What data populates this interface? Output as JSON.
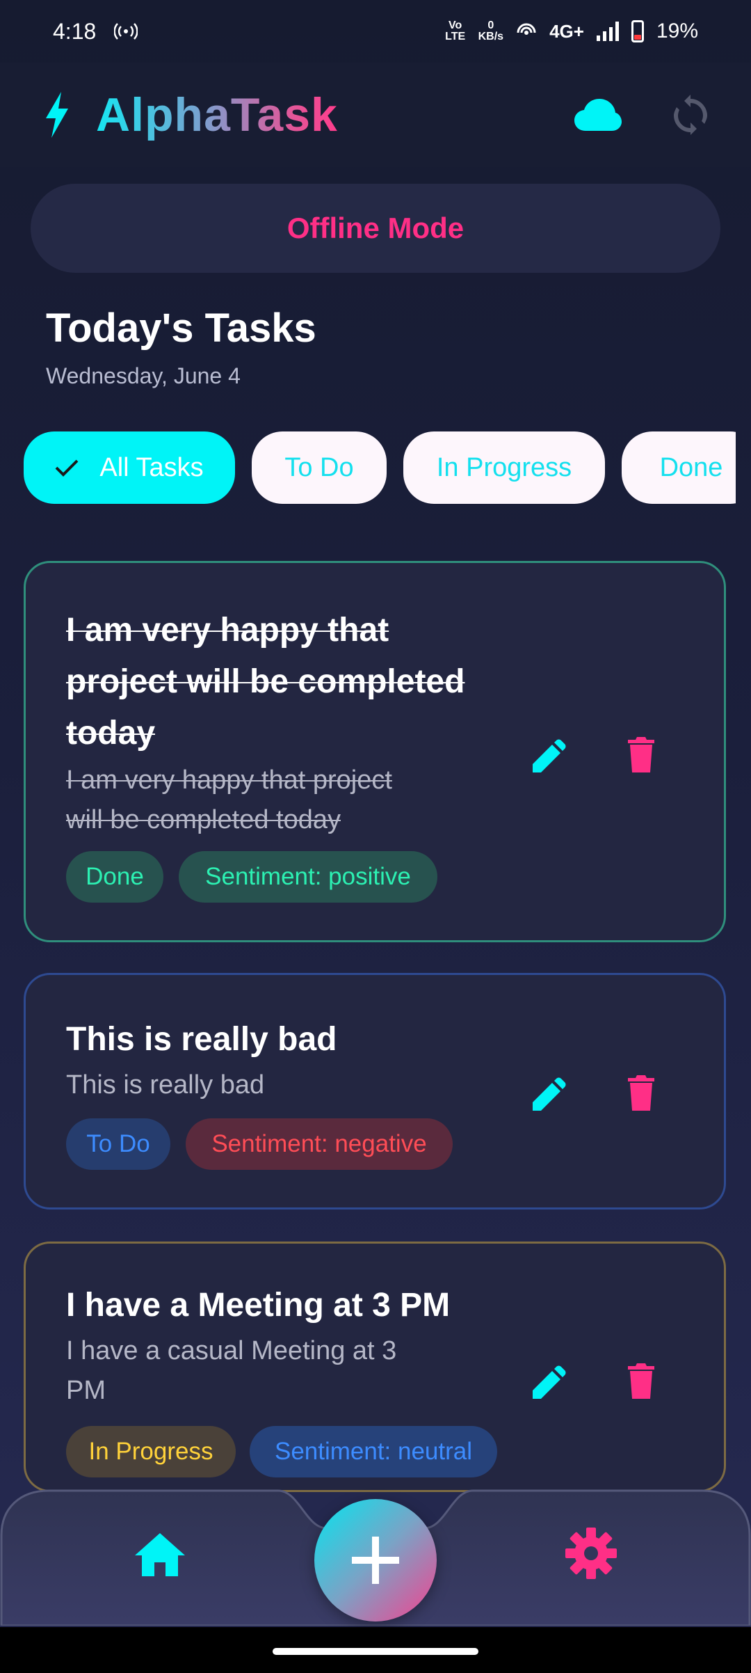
{
  "status_bar": {
    "time": "4:18",
    "volte": "Vo LTE",
    "speed_value": "0",
    "speed_unit": "KB/s",
    "network": "4G+",
    "battery": "19%"
  },
  "app": {
    "title": "AlphaTask",
    "logo_icon": "lightning-bolt-icon",
    "cloud_icon": "cloud-icon",
    "sync_icon": "sync-icon",
    "colors": {
      "accent_cyan": "#00f4f7",
      "accent_pink": "#ff2f86"
    }
  },
  "offline_banner": {
    "text": "Offline Mode"
  },
  "header": {
    "title": "Today's Tasks",
    "date": "Wednesday, June 4"
  },
  "filters": [
    {
      "label": "All Tasks",
      "active": true
    },
    {
      "label": "To Do",
      "active": false
    },
    {
      "label": "In Progress",
      "active": false
    },
    {
      "label": "Done",
      "active": false
    }
  ],
  "tasks": [
    {
      "title_lines": [
        "I am very happy that",
        "project will be completed",
        "today"
      ],
      "description_lines": [
        "I am very happy that project",
        "will be completed today"
      ],
      "status": "Done",
      "sentiment": "Sentiment: positive",
      "completed": true
    },
    {
      "title_lines": [
        "This is really bad"
      ],
      "description_lines": [
        "This is really bad"
      ],
      "status": "To Do",
      "sentiment": "Sentiment: negative",
      "completed": false
    },
    {
      "title_lines": [
        "I have a Meeting at 3 PM"
      ],
      "description_lines": [
        "I have a casual Meeting at 3",
        "PM"
      ],
      "status": "In Progress",
      "sentiment": "Sentiment: neutral",
      "completed": false
    }
  ],
  "bottom_nav": {
    "home_icon": "home-icon",
    "add_icon": "plus-icon",
    "settings_icon": "gear-icon"
  }
}
